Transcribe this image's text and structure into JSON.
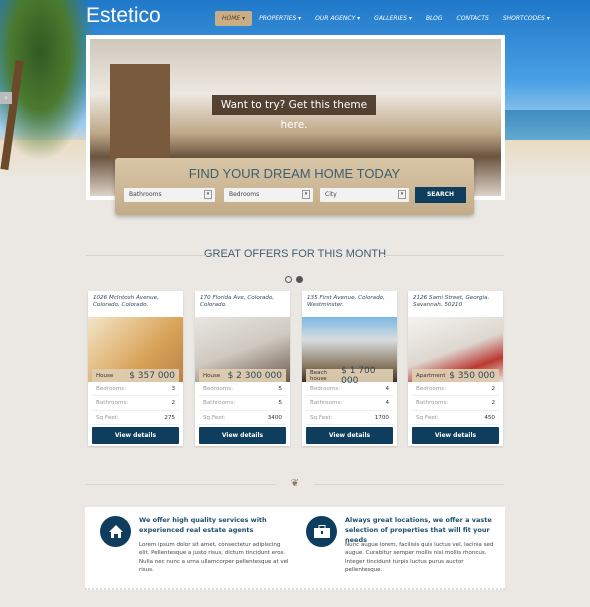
{
  "header": {
    "logo": "Estetico",
    "nav": [
      {
        "label": "HOME",
        "active": true,
        "dropdown": true
      },
      {
        "label": "PROPERTIES",
        "dropdown": true
      },
      {
        "label": "OUR AGENCY",
        "dropdown": true
      },
      {
        "label": "GALLERIES",
        "dropdown": true
      },
      {
        "label": "BLOG"
      },
      {
        "label": "CONTACTS"
      },
      {
        "label": "SHORTCODES",
        "dropdown": true
      }
    ]
  },
  "hero": {
    "cta": "Want to try? Get this theme here."
  },
  "search": {
    "title": "FIND YOUR DREAM HOME TODAY",
    "bathrooms": "Bathrooms",
    "bedrooms": "Bedrooms",
    "city": "City",
    "button": "SEARCH"
  },
  "offers": {
    "title": "GREAT OFFERS FOR THIS MONTH",
    "page": 1,
    "pages": 2
  },
  "labels": {
    "bedrooms": "Bedrooms:",
    "bathrooms": "Bathrooms:",
    "sqft": "Sq Feet:",
    "view": "View details"
  },
  "cards": [
    {
      "address": "1026 McIntosh Avenue, Colorado, Colorado.",
      "type": "House",
      "price": "$ 357 000",
      "bedrooms": "3",
      "bathrooms": "2",
      "sqft": "275"
    },
    {
      "address": "170 Florida Ave, Colorado, Colorado.",
      "type": "House",
      "price": "$ 2 300 000",
      "bedrooms": "5",
      "bathrooms": "5",
      "sqft": "3400"
    },
    {
      "address": "135 First Avenue, Colorado, Westminster.",
      "type": "Beach house",
      "price": "$ 1 700 000",
      "bedrooms": "4",
      "bathrooms": "4",
      "sqft": "1700"
    },
    {
      "address": "2126 Sami Street, Georgia, Savannah, 50210",
      "type": "Apartment",
      "price": "$ 350 000",
      "bedrooms": "2",
      "bathrooms": "2",
      "sqft": "450"
    }
  ],
  "features": [
    {
      "icon": "house-icon",
      "title": "We offer high quality services with experienced real estate agents",
      "text": "Lorem ipsum dolor sit amet, consectetur adipiscing elit. Pellentesque a justo risus, dictum tincidunt eros. Nulla nec nunc a urna ullamcorper pellentesque at vel risus."
    },
    {
      "icon": "briefcase-icon",
      "title": "Always great locations, we offer a vaste selection of properties that will fit your needs",
      "text": "Nunc augue lorem, facilisis quis luctus vel, lacinia sed augue. Curabitur semper mollis nisl mollis rhoncus. Integer tincidunt turpis luctus purus auctor pellentesque."
    }
  ],
  "colors": {
    "primary": "#0e3d5e",
    "accent": "#c9ad85",
    "heading": "#3e5d6e"
  }
}
